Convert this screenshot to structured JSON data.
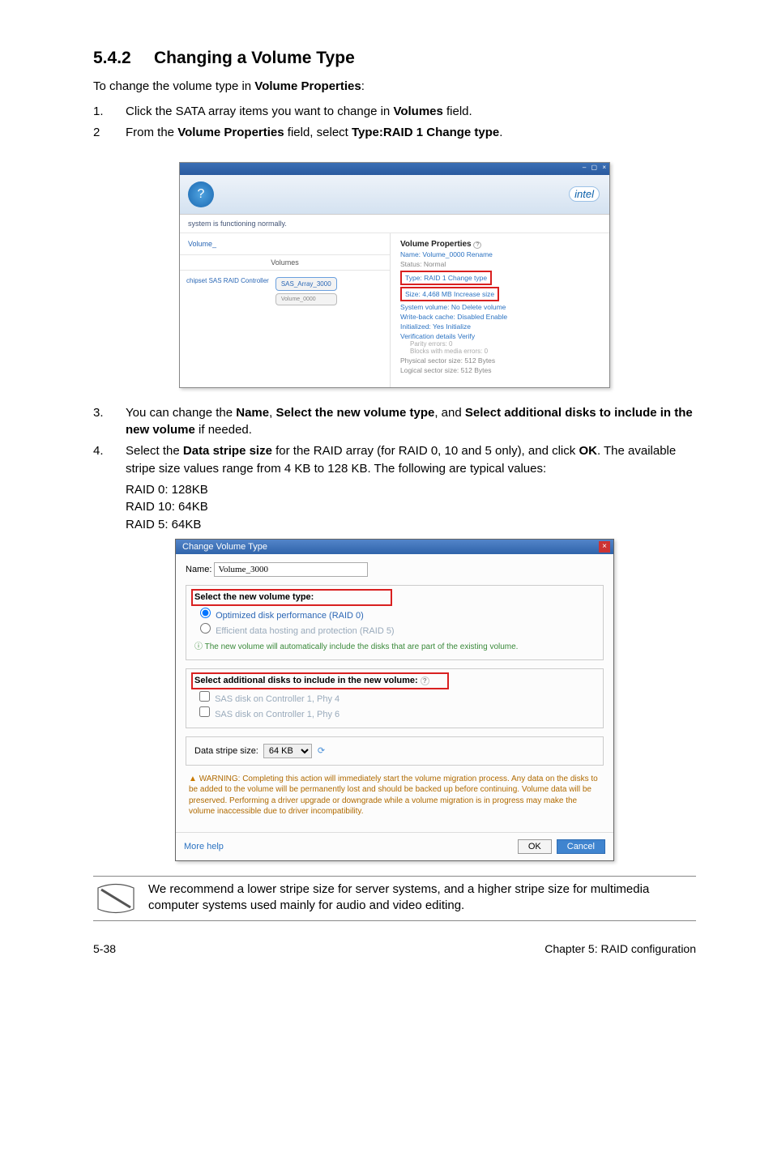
{
  "heading": {
    "number": "5.4.2",
    "title": "Changing a Volume Type"
  },
  "intro": {
    "pre": "To change the volume type in ",
    "bold": "Volume Properties",
    "post": ":"
  },
  "steps12": [
    {
      "num": "1.",
      "pre": "Click the SATA array items you want to change in ",
      "b1": "Volumes",
      "post": " field."
    },
    {
      "num": "2",
      "pre": "From the ",
      "b1": "Volume Properties",
      "mid": " field, select ",
      "b2": "Type:RAID 1 Change type",
      "post": "."
    }
  ],
  "intelshot": {
    "winbtns": "– ▢ ×",
    "badge": "?",
    "logo": "intel",
    "status": "system is functioning normally.",
    "left": {
      "volumeLabel": "Volume_",
      "volumesHdr": "Volumes",
      "controller": "chipset SAS RAID Controller",
      "chipTop": "SAS_Array_3000",
      "chipBot": "Volume_0000"
    },
    "right": {
      "title": "Volume Properties",
      "q": "?",
      "name": "Name: Volume_0000 Rename",
      "statusN": "Status: Normal",
      "typeLine": "Type: RAID 1 Change type",
      "sizeLine": "Size: 4,468 MB  Increase size",
      "l1": "System volume: No  Delete volume",
      "l2": "Write-back cache: Disabled  Enable",
      "l3": "Initialized: Yes  Initialize",
      "l4": "Verification details  Verify",
      "l5": "Parity errors: 0",
      "l6": "Blocks with media errors: 0",
      "l7": "Physical sector size: 512 Bytes",
      "l8": "Logical sector size: 512 Bytes"
    }
  },
  "steps34": {
    "s3": {
      "num": "3.",
      "pre": "You can change the ",
      "b1": "Name",
      "mid1": ", ",
      "b2": "Select the new volume type",
      "mid2": ", and ",
      "b3": "Select additional disks to include in the new volume",
      "post": " if needed."
    },
    "s4": {
      "num": "4.",
      "pre": "Select the ",
      "b1": "Data stripe size",
      "mid1": " for the RAID array (for RAID 0, 10 and 5 only), and click ",
      "b2": "OK",
      "post": ". The available stripe size values range from 4 KB to 128 KB. The following are typical values:"
    },
    "raid0": "RAID 0: 128KB",
    "raid10": "RAID 10: 64KB",
    "raid5": "RAID 5: 64KB"
  },
  "dlg": {
    "title": "Change Volume Type",
    "close": "×",
    "nameLbl": "Name:",
    "nameVal": "Volume_3000",
    "g1": {
      "title": "Select the new volume type:",
      "opt1": "Optimized disk performance (RAID 0)",
      "opt2": "Efficient data hosting and protection (RAID 5)",
      "hint": "The new volume will automatically include the disks that are part of the existing volume."
    },
    "g2": {
      "title": "Select additional disks to include in the new volume:",
      "d1": "SAS disk on Controller 1, Phy 4",
      "d2": "SAS disk on Controller 1, Phy 6"
    },
    "stripeLbl": "Data stripe size:",
    "stripeVal": "64 KB",
    "warn": "WARNING: Completing this action will immediately start the volume migration process. Any data on the disks to be added to the volume will be permanently lost and should be backed up before continuing. Volume data will be preserved. Performing a driver upgrade or downgrade while a volume migration is in progress may make the volume inaccessible due to driver incompatibility.",
    "more": "More help",
    "ok": "OK",
    "cancel": "Cancel"
  },
  "note": "We recommend a lower stripe size for server systems, and a higher stripe size for multimedia computer systems used mainly for audio and video editing.",
  "footer": {
    "left": "5-38",
    "right": "Chapter 5: RAID configuration"
  }
}
